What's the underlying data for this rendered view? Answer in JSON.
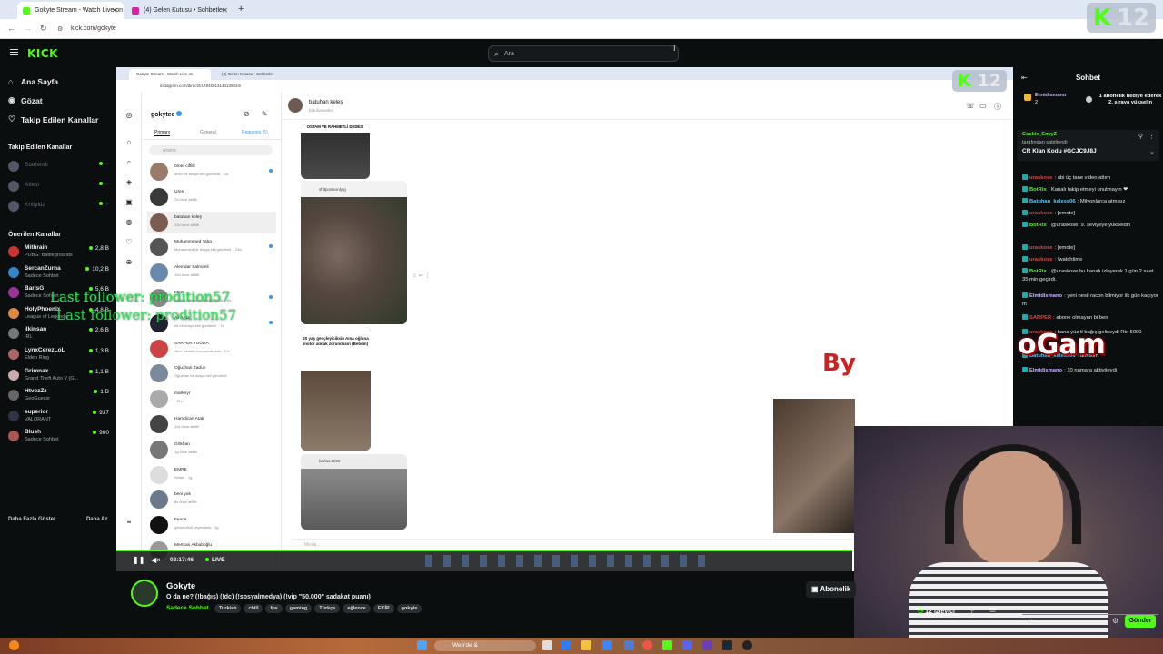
{
  "browser": {
    "tabs": [
      {
        "label": "Gokyte Stream - Watch Live on",
        "fav_color": "#53fc18"
      },
      {
        "label": "(4) Gelen Kutusu • Sohbetler",
        "fav_color": "#d6249f"
      }
    ],
    "url": "kick.com/gokyte"
  },
  "overlay_badge": {
    "logo": "K",
    "number": "12"
  },
  "header": {
    "logo": "KICK",
    "search_placeholder": "Ara"
  },
  "sidebar": {
    "nav": [
      {
        "label": "Ana Sayfa",
        "icon": "home-icon"
      },
      {
        "label": "Gözat",
        "icon": "browse-icon"
      },
      {
        "label": "Takip Edilen Kanallar",
        "icon": "heart-icon"
      }
    ],
    "followed_title": "Takip Edilen Kanallar",
    "followed": [
      {
        "name": "Starlendi",
        "color": "#556"
      },
      {
        "name": "Atlesi",
        "color": "#556"
      },
      {
        "name": "Kritiyidz",
        "color": "#556"
      }
    ],
    "recommended_title": "Önerilen Kanallar",
    "recommended": [
      {
        "name": "Mithrain",
        "game": "PUBG: Battlegrounds",
        "viewers": "2,8 B",
        "color": "#c33"
      },
      {
        "name": "SercanZurna",
        "game": "Sadece Sohbet",
        "viewers": "10,2 B",
        "color": "#38c"
      },
      {
        "name": "BarisG",
        "game": "Sadece Sohbet",
        "viewers": "5,6 B",
        "color": "#939"
      },
      {
        "name": "HolyPhoenix",
        "game": "League of Legends",
        "viewers": "4,8 B",
        "color": "#d84"
      },
      {
        "name": "ilkinsan",
        "game": "IRL",
        "viewers": "2,6 B",
        "color": "#777"
      },
      {
        "name": "LynxCerezLoL",
        "game": "Elden Ring",
        "viewers": "1,3 B",
        "color": "#a66"
      },
      {
        "name": "Grimnax",
        "game": "Grand Theft Auto V (G...",
        "viewers": "1,1 B",
        "color": "#caa"
      },
      {
        "name": "HtvezZz",
        "game": "GeoGuessr",
        "viewers": "1 B",
        "color": "#666"
      },
      {
        "name": "superior",
        "game": "VALORANT",
        "viewers": "937",
        "color": "#334"
      },
      {
        "name": "Blush",
        "game": "Sadece Sohbet",
        "viewers": "900",
        "color": "#a55"
      }
    ],
    "show_more": "Daha Fazla Göster",
    "show_less": "Daha Az"
  },
  "video": {
    "inner_tabs": [
      "Gokyte Stream - Watch Live on",
      "(4) Gelen Kutusu • Sohbetler"
    ],
    "inner_url": "instagram.com/direct/t/17845013144135034/",
    "instagram": {
      "username": "gokytee",
      "tabs": [
        "Primary",
        "General",
        "Requests (5)"
      ],
      "search_placeholder": "Arama",
      "conversations": [
        {
          "name": "ömer ciftlik",
          "preview": "ömer bir dosya ekli gönderdi. · 1d",
          "unread": true
        },
        {
          "name": "Ures",
          "preview": "7d önce aktifti",
          "unread": false
        },
        {
          "name": "batuhan keleş",
          "preview": "23d önce aktifti",
          "unread": false
        },
        {
          "name": "Muhammmed Taha",
          "preview": "Muhammed bir dosya ekli gönderdi. · 23d",
          "unread": true
        },
        {
          "name": "Alemdar Salmanli",
          "preview": "16d önce aktifti",
          "unread": false
        },
        {
          "name": "Mert",
          "preview": "Kamile bir dosya ekli gönderdi. · 6d",
          "unread": true
        },
        {
          "name": "Ali Arda",
          "preview": "Ali bir dosya ekli gönderdi. · 7s",
          "unread": true
        },
        {
          "name": "SARPER TUĞRA",
          "preview": "Yeni: Seninle konuşmak ister · 11s",
          "unread": false
        },
        {
          "name": "Oğuzhan Zadun",
          "preview": "Oğuzhan bir dosya ekli gönderdi",
          "unread": false
        },
        {
          "name": "marknyr",
          "preview": "· 21s",
          "unread": false
        },
        {
          "name": "Hamdican Atak",
          "preview": "11d önce aktifti",
          "unread": false
        },
        {
          "name": "Gökhan",
          "preview": "1g önce aktifti",
          "unread": false
        },
        {
          "name": "EMRE",
          "preview": "Selam · 1g",
          "unread": false
        },
        {
          "name": "beni yok",
          "preview": "8s önce aktifti",
          "unread": false
        },
        {
          "name": "Fence",
          "preview": "görüntüledi beyanlandı · 1g",
          "unread": false
        },
        {
          "name": "Mertcan Akbaboğlu",
          "preview": "",
          "unread": false
        }
      ],
      "chat_name": "batuhan keleş",
      "chat_handle": "batuhankeles",
      "caption1": "OSTAM VE RAHMETLİ DEDESİ",
      "post_account": "shitpostsonlytg",
      "caption3": "20 yaş gençleyiciksin Ama oğluna motor almak zorundasın (Bebem)",
      "post_account2": "barlas.1969",
      "message_placeholder": "Mesaj..."
    },
    "overlay_follower": "Last follower: prodition57",
    "overlay_byline": "By",
    "overlay_logo": "oGam"
  },
  "player": {
    "time": "02:17:46",
    "live": "LIVE"
  },
  "stream": {
    "name": "Gokyte",
    "title": "O da ne? (!bağış) (!dc) (!sosyalmedya) (!vip \"50.000\" sadakat puanı)",
    "category": "Sadece Sohbet",
    "tags": [
      "Turkish",
      "chill",
      "fps",
      "gaming",
      "Türkçe",
      "eğlence",
      "EKİP",
      "gokyte"
    ],
    "subscribe": "Abonelik"
  },
  "chat": {
    "title": "Sohbet",
    "gift": {
      "user": "Elmidismano",
      "count": "2",
      "text": "1 abonelik hediye ederek 2. sıraya yükselin"
    },
    "pinned": {
      "user": "Cookie_EnvyZ",
      "by": "tarafından sabitlendi",
      "text": "CR Klan Kodu #GCJC9J8J"
    },
    "messages": [
      {
        "user": "uraskose",
        "text": "abi üç tane video attım",
        "color": "#e04444"
      },
      {
        "user": "BotRix",
        "text": "Kanalı takip etmeyi unutmayın ❤",
        "color": "#53fc18"
      },
      {
        "user": "Batuhan_keless06",
        "text": "Milyonlarca atmışız",
        "color": "#56c8ff"
      },
      {
        "user": "uraskose",
        "text": "[emote]",
        "color": "#e04444"
      },
      {
        "user": "BotRix",
        "text": "@uraskose, 9. seviyeye yükseldin",
        "color": "#53fc18"
      },
      {
        "user": "uraskose",
        "text": "[emote]",
        "color": "#e04444"
      },
      {
        "user": "uraskose",
        "text": "!watchtime",
        "color": "#e04444"
      },
      {
        "user": "BotRix",
        "text": "@uraskose bu kanalı izleyerek 1 gün 2 saat 35 min geçirdi.",
        "color": "#53fc18"
      },
      {
        "user": "Elmidismano",
        "text": "yeni nesil racon bilmiyor ilk gün kaçıyor m",
        "color": "#c9b5ff"
      },
      {
        "user": "SARPER",
        "text": "abone olmayan bi ben",
        "color": "#e04444"
      },
      {
        "user": "uraskose",
        "text": "bana yüz tl bağış geliseydi Rtx 5090",
        "color": "#e04444"
      },
      {
        "user": "Batuhan_keless06",
        "text": "atmisim",
        "color": "#56c8ff"
      },
      {
        "user": "Elmidismano",
        "text": "10 numara aktiviteydi",
        "color": "#c9b5ff"
      }
    ],
    "viewers": "12 İzleyici",
    "send": "Gönder"
  },
  "taskbar": {
    "search_placeholder": "Web'de &"
  }
}
